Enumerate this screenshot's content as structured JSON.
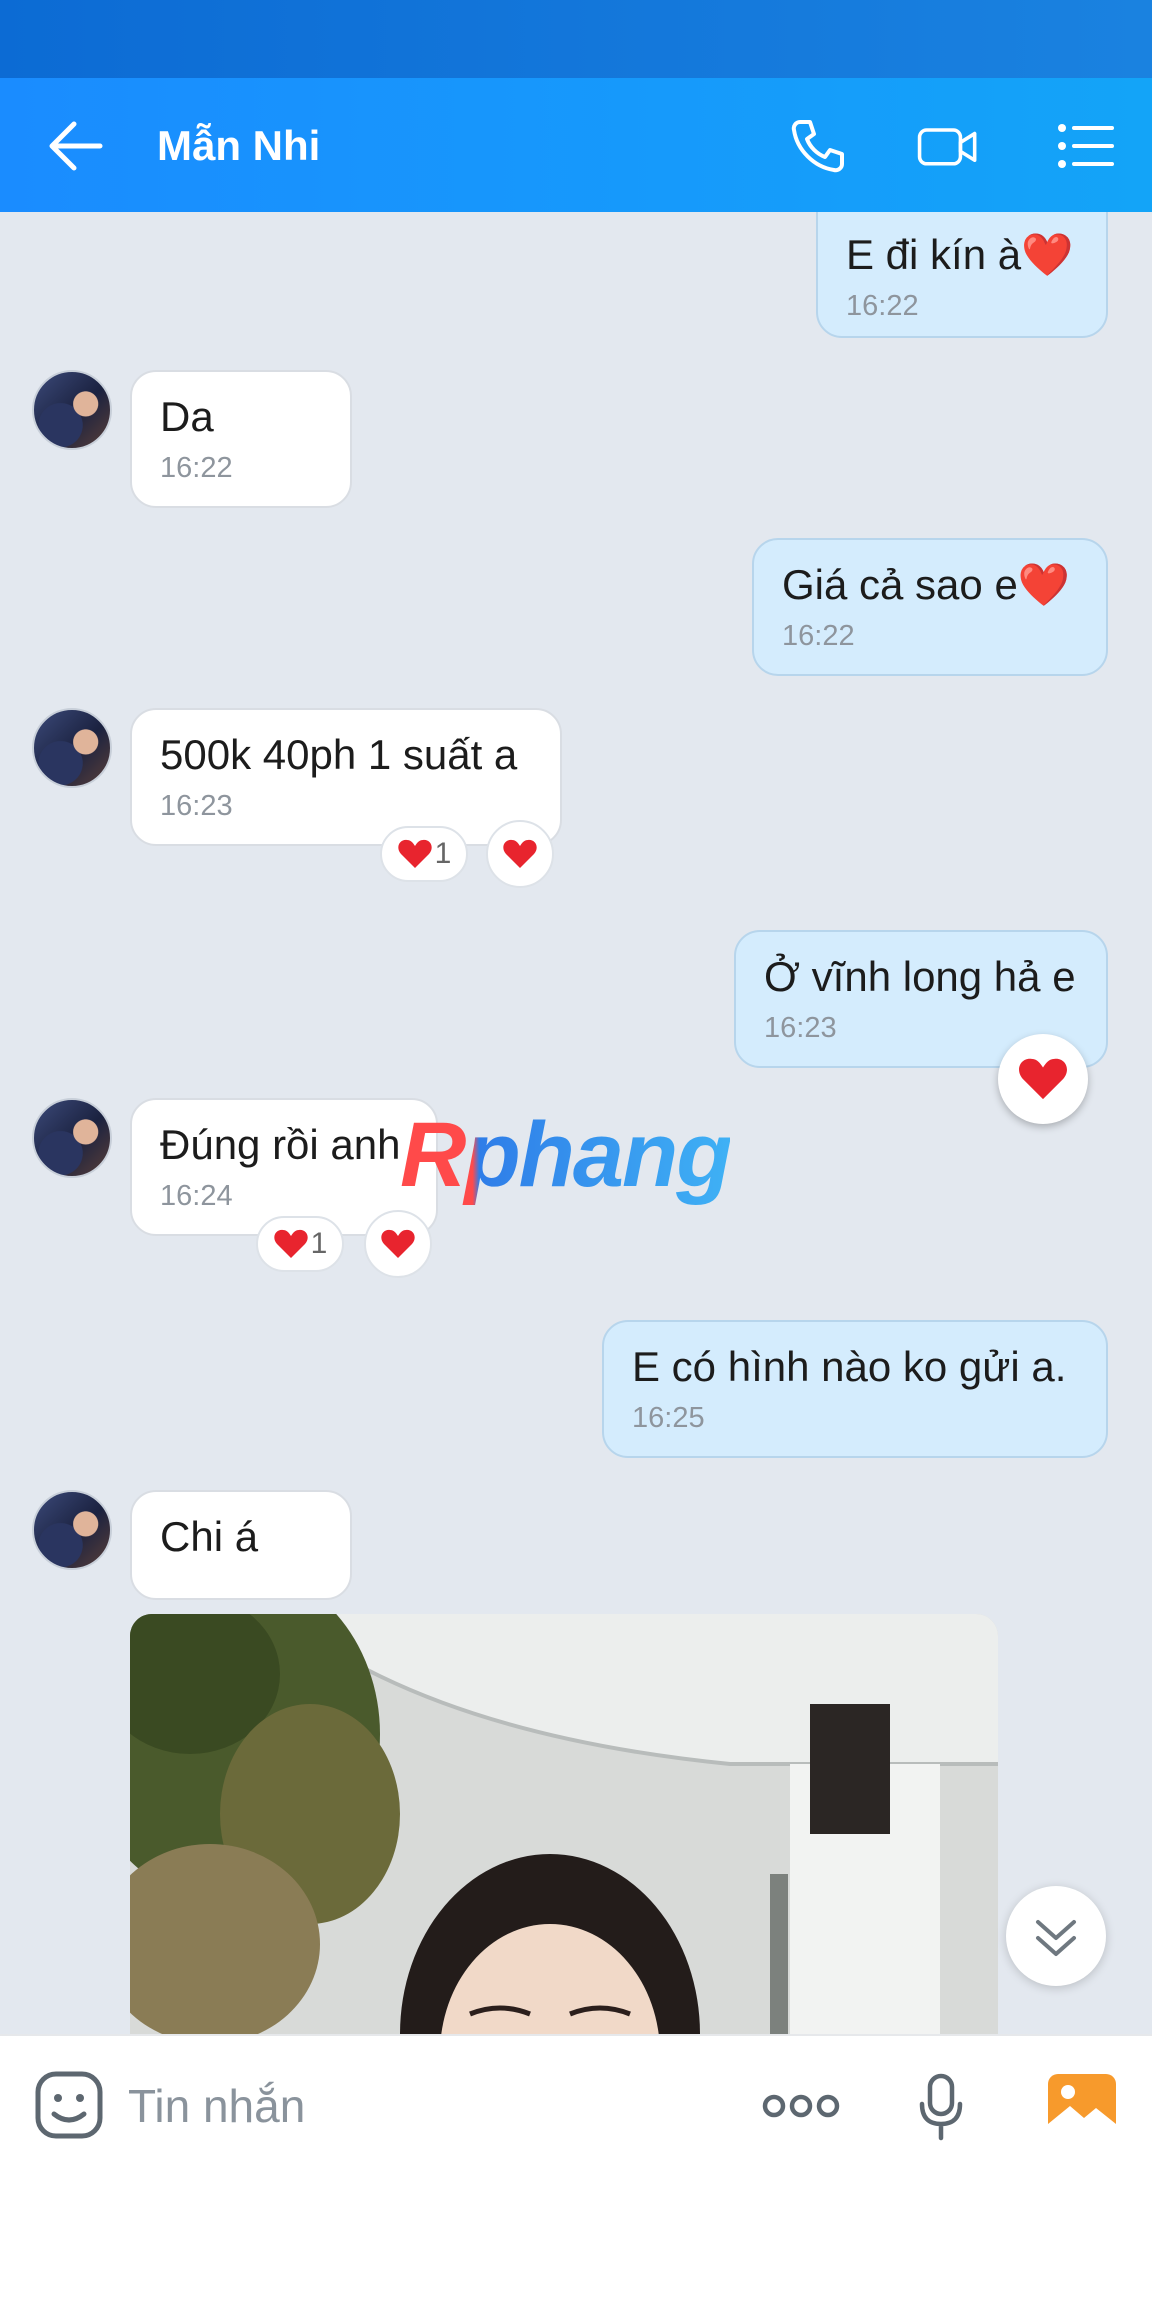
{
  "header": {
    "contact_name": "Mẫn Nhi"
  },
  "messages": [
    {
      "side": "out",
      "text": "E đi kín à❤️",
      "time": "16:22"
    },
    {
      "side": "in",
      "text": "Da",
      "time": "16:22"
    },
    {
      "side": "out",
      "text": "Giá cả sao e❤️",
      "time": "16:22"
    },
    {
      "side": "in",
      "text": "500k 40ph 1 suất a",
      "time": "16:23",
      "reaction_count": "1"
    },
    {
      "side": "out",
      "text": "Ở vĩnh long hả e",
      "time": "16:23"
    },
    {
      "side": "in",
      "text": "Đúng rồi anh",
      "time": "16:24",
      "reaction_count": "1"
    },
    {
      "side": "out",
      "text": "E có hình nào ko gửi a.",
      "time": "16:25"
    },
    {
      "side": "in",
      "text": "Chi á",
      "time": ""
    }
  ],
  "watermark": "Rphang",
  "input": {
    "placeholder": "Tin nhắn"
  },
  "colors": {
    "header": "#1a8cff",
    "background": "#e3e8ef",
    "outgoing_bubble": "#d4ecfd",
    "incoming_bubble": "#ffffff",
    "heart": "#e8242e"
  }
}
